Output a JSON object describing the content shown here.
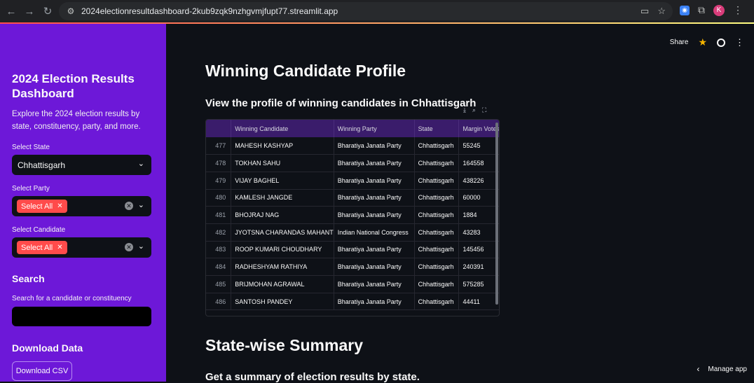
{
  "browser": {
    "url": "2024electionresultdashboard-2kub9zqk9nzhgvmjfupt77.streamlit.app",
    "profile_initial": "K"
  },
  "sidebar": {
    "title": "2024 Election Results Dashboard",
    "description": "Explore the 2024 election results by state, constituency, party, and more.",
    "state_label": "Select State",
    "state_value": "Chhattisgarh",
    "party_label": "Select Party",
    "party_tag": "Select All",
    "candidate_label": "Select Candidate",
    "candidate_tag": "Select All",
    "search_heading": "Search",
    "search_label": "Search for a candidate or constituency",
    "search_value": "",
    "download_heading": "Download Data",
    "download_button": "Download CSV"
  },
  "main": {
    "share_label": "Share",
    "title": "Winning Candidate Profile",
    "subtitle": "View the profile of winning candidates in Chhattisgarh",
    "summary_title": "State-wise Summary",
    "summary_subtitle": "Get a summary of election results by state.",
    "manage_app": "Manage app",
    "table": {
      "columns": [
        "",
        "Winning Candidate",
        "Winning Party",
        "State",
        "Margin Votes"
      ],
      "rows": [
        [
          "477",
          "MAHESH KASHYAP",
          "Bharatiya Janata Party",
          "Chhattisgarh",
          "55245"
        ],
        [
          "478",
          "TOKHAN SAHU",
          "Bharatiya Janata Party",
          "Chhattisgarh",
          "164558"
        ],
        [
          "479",
          "VIJAY BAGHEL",
          "Bharatiya Janata Party",
          "Chhattisgarh",
          "438226"
        ],
        [
          "480",
          "KAMLESH JANGDE",
          "Bharatiya Janata Party",
          "Chhattisgarh",
          "60000"
        ],
        [
          "481",
          "BHOJRAJ NAG",
          "Bharatiya Janata Party",
          "Chhattisgarh",
          "1884"
        ],
        [
          "482",
          "JYOTSNA CHARANDAS MAHANT",
          "Indian National Congress",
          "Chhattisgarh",
          "43283"
        ],
        [
          "483",
          "ROOP KUMARI CHOUDHARY",
          "Bharatiya Janata Party",
          "Chhattisgarh",
          "145456"
        ],
        [
          "484",
          "RADHESHYAM RATHIYA",
          "Bharatiya Janata Party",
          "Chhattisgarh",
          "240391"
        ],
        [
          "485",
          "BRIJMOHAN AGRAWAL",
          "Bharatiya Janata Party",
          "Chhattisgarh",
          "575285"
        ],
        [
          "486",
          "SANTOSH PANDEY",
          "Bharatiya Janata Party",
          "Chhattisgarh",
          "44411"
        ]
      ]
    }
  },
  "colors": {
    "sidebar_bg": "#6d18d8",
    "main_bg": "#0e1117",
    "accent": "#ff4b4b",
    "header_bg": "#3a1c6b"
  }
}
